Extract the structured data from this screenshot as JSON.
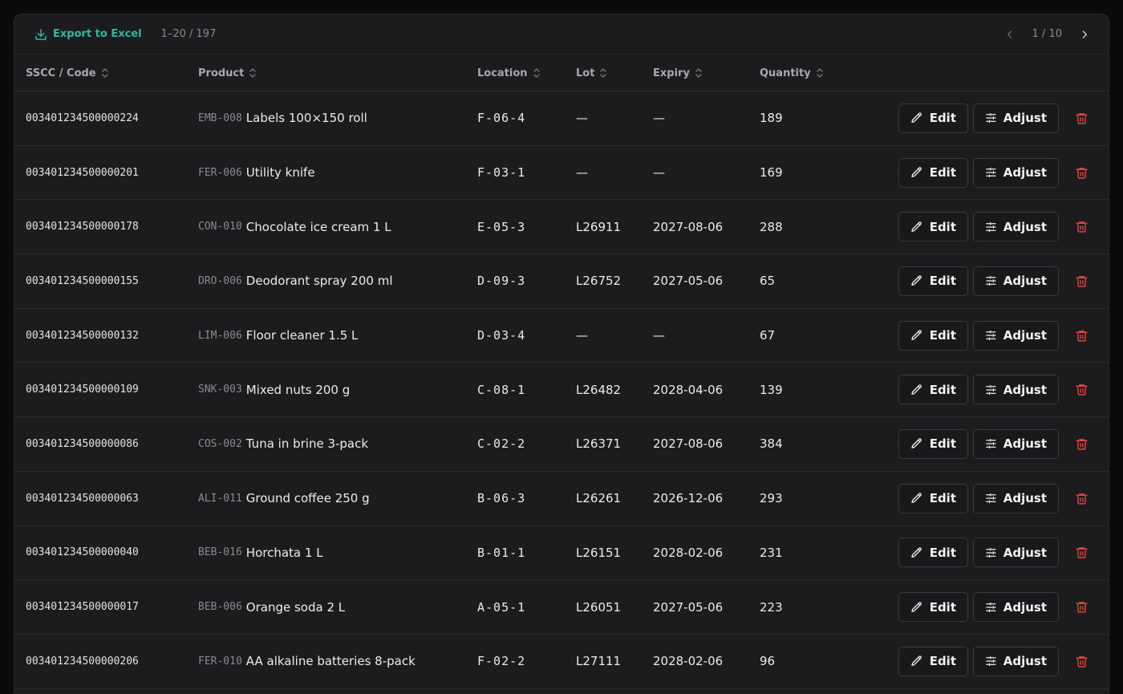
{
  "toolbar": {
    "export_label": "Export to Excel",
    "range": "1–20 / 197",
    "page": "1 / 10"
  },
  "columns": [
    "SSCC / Code",
    "Product",
    "Location",
    "Lot",
    "Expiry",
    "Quantity"
  ],
  "actions": {
    "edit": "Edit",
    "adjust": "Adjust"
  },
  "rows": [
    {
      "code": "003401234500000224",
      "sku": "EMB-008",
      "product": "Labels 100×150 roll",
      "location": "F-06-4",
      "lot": "—",
      "expiry": "—",
      "qty": "189"
    },
    {
      "code": "003401234500000201",
      "sku": "FER-006",
      "product": "Utility knife",
      "location": "F-03-1",
      "lot": "—",
      "expiry": "—",
      "qty": "169"
    },
    {
      "code": "003401234500000178",
      "sku": "CON-010",
      "product": "Chocolate ice cream 1 L",
      "location": "E-05-3",
      "lot": "L26911",
      "expiry": "2027-08-06",
      "qty": "288"
    },
    {
      "code": "003401234500000155",
      "sku": "DRO-006",
      "product": "Deodorant spray 200 ml",
      "location": "D-09-3",
      "lot": "L26752",
      "expiry": "2027-05-06",
      "qty": "65"
    },
    {
      "code": "003401234500000132",
      "sku": "LIM-006",
      "product": "Floor cleaner 1.5 L",
      "location": "D-03-4",
      "lot": "—",
      "expiry": "—",
      "qty": "67"
    },
    {
      "code": "003401234500000109",
      "sku": "SNK-003",
      "product": "Mixed nuts 200 g",
      "location": "C-08-1",
      "lot": "L26482",
      "expiry": "2028-04-06",
      "qty": "139"
    },
    {
      "code": "003401234500000086",
      "sku": "COS-002",
      "product": "Tuna in brine 3-pack",
      "location": "C-02-2",
      "lot": "L26371",
      "expiry": "2027-08-06",
      "qty": "384"
    },
    {
      "code": "003401234500000063",
      "sku": "ALI-011",
      "product": "Ground coffee 250 g",
      "location": "B-06-3",
      "lot": "L26261",
      "expiry": "2026-12-06",
      "qty": "293"
    },
    {
      "code": "003401234500000040",
      "sku": "BEB-016",
      "product": "Horchata 1 L",
      "location": "B-01-1",
      "lot": "L26151",
      "expiry": "2028-02-06",
      "qty": "231"
    },
    {
      "code": "003401234500000017",
      "sku": "BEB-006",
      "product": "Orange soda 2 L",
      "location": "A-05-1",
      "lot": "L26051",
      "expiry": "2027-05-06",
      "qty": "223"
    },
    {
      "code": "003401234500000206",
      "sku": "FER-010",
      "product": "AA alkaline batteries 8-pack",
      "location": "F-02-2",
      "lot": "L27111",
      "expiry": "2028-02-06",
      "qty": "96"
    }
  ]
}
